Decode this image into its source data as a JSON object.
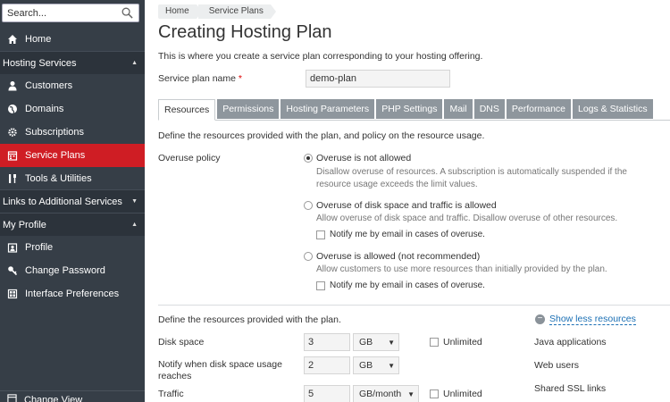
{
  "sidebar": {
    "search_placeholder": "Search...",
    "home": "Home",
    "hosting_services": "Hosting Services",
    "customers": "Customers",
    "domains": "Domains",
    "subscriptions": "Subscriptions",
    "service_plans": "Service Plans",
    "tools_utilities": "Tools & Utilities",
    "links_additional": "Links to Additional Services",
    "my_profile": "My Profile",
    "profile": "Profile",
    "change_password": "Change Password",
    "interface_preferences": "Interface Preferences",
    "change_view": "Change View"
  },
  "breadcrumb": [
    "Home",
    "Service Plans"
  ],
  "page": {
    "title": "Creating Hosting Plan",
    "description": "This is where you create a service plan corresponding to your hosting offering.",
    "plan_name_label": "Service plan name",
    "plan_name_required": "*",
    "plan_name_value": "demo-plan"
  },
  "tabs": [
    "Resources",
    "Permissions",
    "Hosting Parameters",
    "PHP Settings",
    "Mail",
    "DNS",
    "Performance",
    "Logs & Statistics"
  ],
  "resources": {
    "section_desc": "Define the resources provided with the plan, and policy on the resource usage.",
    "overuse_label": "Overuse policy",
    "opt1_label": "Overuse is not allowed",
    "opt1_hint": "Disallow overuse of resources. A subscription is automatically suspended if the resource usage exceeds the limit values.",
    "opt2_label": "Overuse of disk space and traffic is allowed",
    "opt2_hint": "Allow overuse of disk space and traffic. Disallow overuse of other resources.",
    "opt2_notify": "Notify me by email in cases of overuse.",
    "opt3_label": "Overuse is allowed (not recommended)",
    "opt3_hint": "Allow customers to use more resources than initially provided by the plan.",
    "opt3_notify": "Notify me by email in cases of overuse.",
    "res_desc": "Define the resources provided with the plan.",
    "show_less": "Show less resources",
    "disk_space_label": "Disk space",
    "disk_space_value": "3",
    "disk_space_unit": "GB",
    "notify_disk_label": "Notify when disk space usage reaches",
    "notify_disk_value": "2",
    "notify_disk_unit": "GB",
    "traffic_label": "Traffic",
    "traffic_value": "5",
    "traffic_unit": "GB/month",
    "unlimited": "Unlimited",
    "java_apps": "Java applications",
    "web_users": "Web users",
    "shared_ssl": "Shared SSL links"
  }
}
